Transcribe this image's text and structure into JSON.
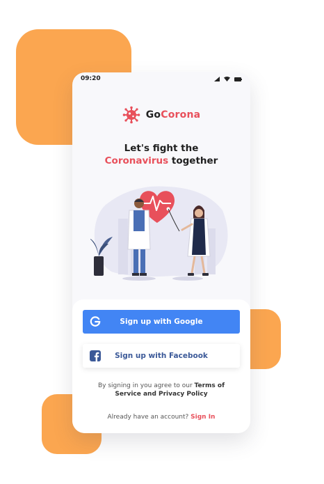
{
  "status_bar": {
    "time": "09:20"
  },
  "brand": {
    "prefix": "Go",
    "accent": "Corona"
  },
  "headline": {
    "line1": "Let's fight the",
    "accent": "Coronavirus",
    "line2_rest": " together"
  },
  "buttons": {
    "google": {
      "label": "Sign up with Google"
    },
    "facebook": {
      "label": "Sign up with Facebook"
    }
  },
  "legal": {
    "text": "By signing in you agree to our ",
    "link": "Terms of Service and Privacy Policy"
  },
  "signin": {
    "prompt": "Already have an account? ",
    "link": "Sign In"
  },
  "colors": {
    "accent": "#E8505B",
    "google": "#4285F4",
    "facebook": "#3B5998",
    "blob": "#FBA650"
  }
}
